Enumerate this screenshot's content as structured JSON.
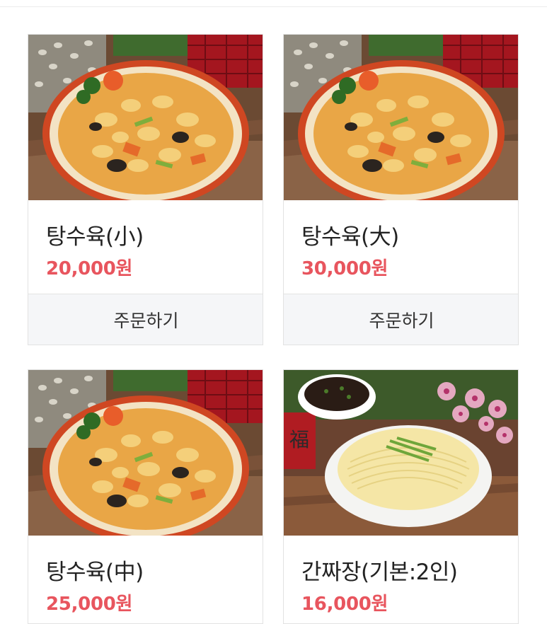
{
  "menu": {
    "items": [
      {
        "name": "탕수육(小)",
        "price": "20,000원",
        "order_label": "주문하기",
        "image": "sweet-and-sour-pork"
      },
      {
        "name": "탕수육(大)",
        "price": "30,000원",
        "order_label": "주문하기",
        "image": "sweet-and-sour-pork"
      },
      {
        "name": "탕수육(中)",
        "price": "25,000원",
        "image": "sweet-and-sour-pork"
      },
      {
        "name": "간짜장(기본:2인)",
        "price": "16,000원",
        "image": "ganjjajang-noodles"
      }
    ]
  },
  "colors": {
    "price": "#e8555e",
    "button_bg": "#f5f6f8",
    "border": "#e2e2e2"
  }
}
